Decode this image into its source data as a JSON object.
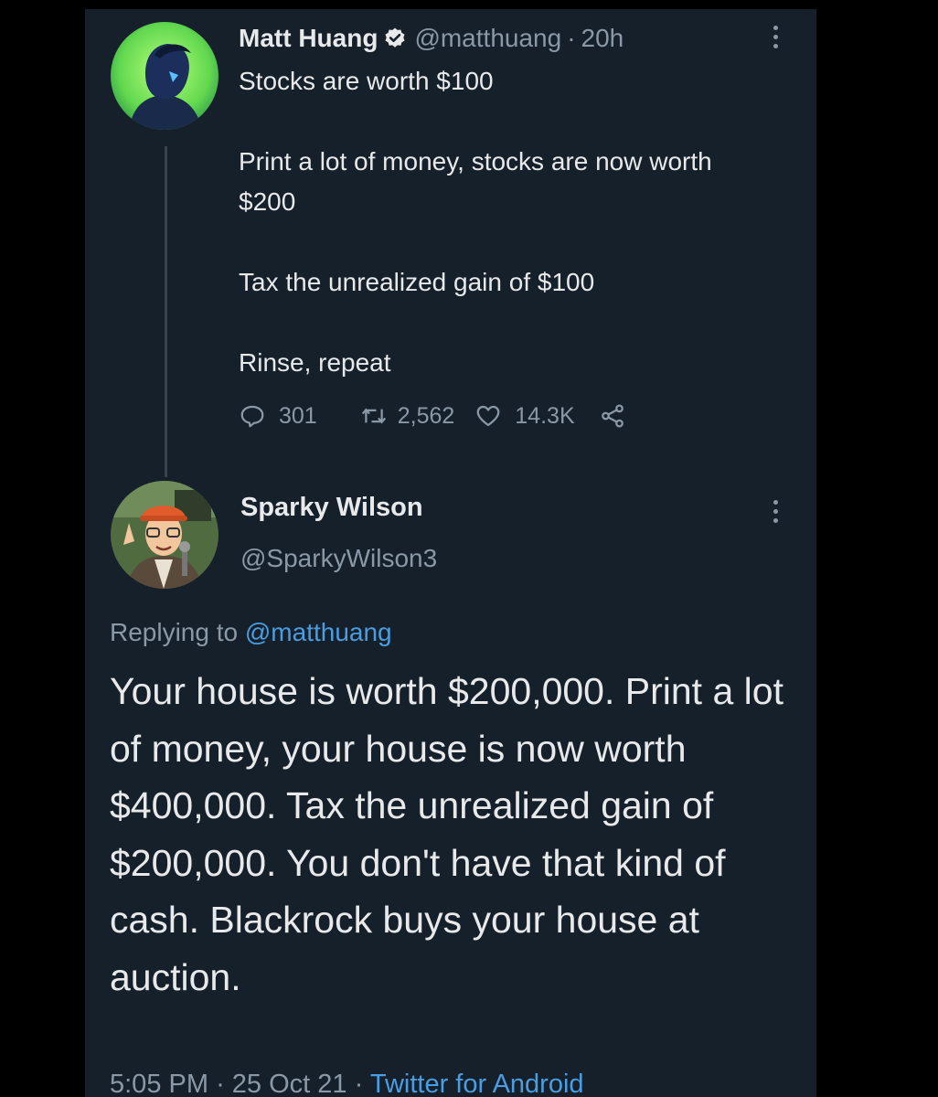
{
  "tweet": {
    "author_name": "Matt Huang",
    "handle": "@matthuang",
    "separator": "·",
    "time_ago": "20h",
    "paragraphs": [
      "Stocks are worth $100",
      "Print a lot of money, stocks are now worth $200",
      "Tax the unrealized gain of $100",
      "Rinse, repeat"
    ],
    "replies": "301",
    "retweets": "2,562",
    "likes": "14.3K",
    "verified": true,
    "icons": [
      "verified-badge-icon",
      "reply-icon",
      "retweet-icon",
      "like-icon",
      "share-icon",
      "more-icon"
    ]
  },
  "reply": {
    "author_name": "Sparky Wilson",
    "handle": "@SparkyWilson3",
    "replying_prefix": "Replying to",
    "replying_to": "@matthuang",
    "text": "Your house is worth $200,000. Print a lot of money, your house is now worth $400,000.  Tax the unrealized gain of $200,000. You don't have that kind of cash. Blackrock buys your house at auction.",
    "time": "5:05 PM",
    "separator": "·",
    "date": "25 Oct 21",
    "source": "Twitter for Android"
  },
  "colors": {
    "background": "#15202b",
    "outer": "#000000",
    "text_primary": "#e7e9ea",
    "text_muted": "#8b98a5",
    "link": "#4a9de0",
    "avatar_ring": "#7ef35a"
  }
}
